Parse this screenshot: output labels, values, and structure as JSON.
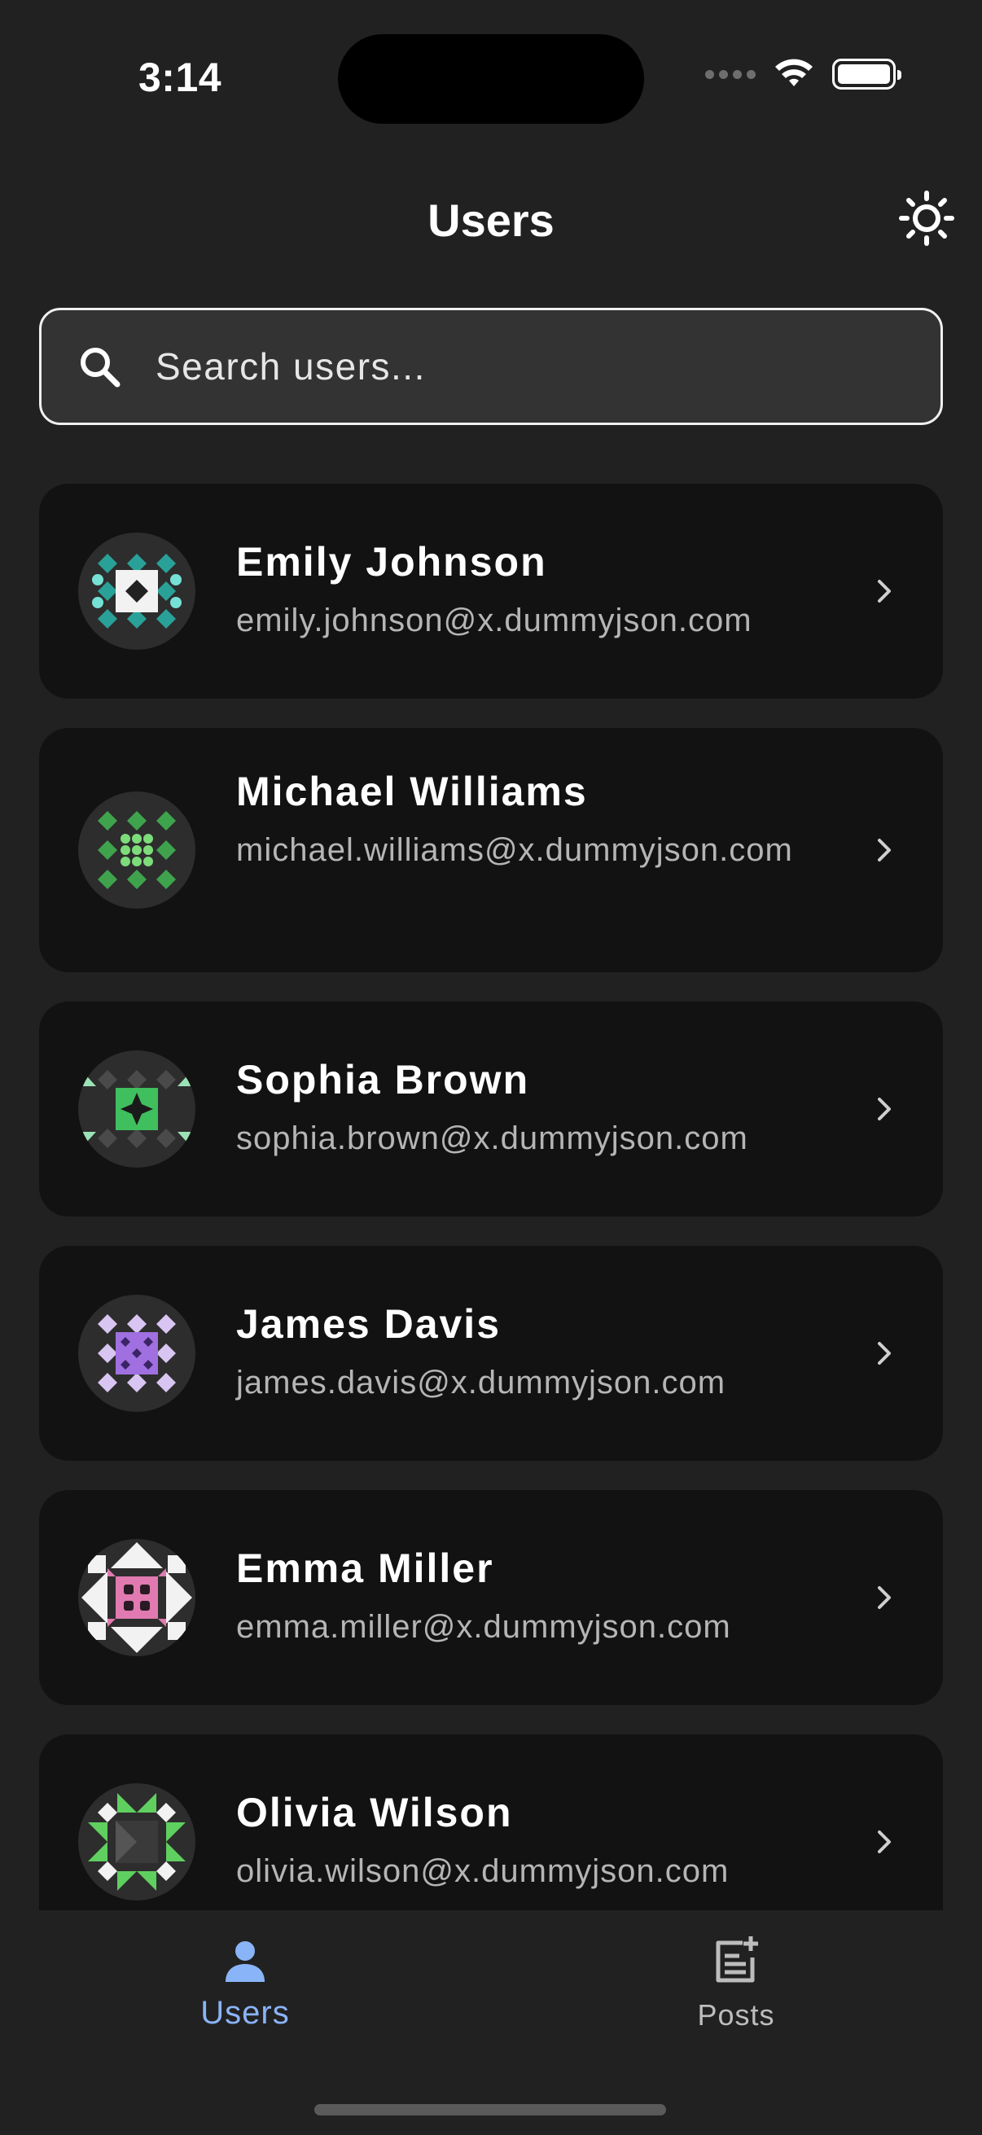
{
  "status_bar": {
    "time": "3:14"
  },
  "header": {
    "title": "Users"
  },
  "search": {
    "placeholder": "Search users..."
  },
  "users": [
    {
      "name": "Emily Johnson",
      "email": "emily.johnson@x.dummyjson.com"
    },
    {
      "name": "Michael Williams",
      "email": "michael.williams@x.dummyjson.com"
    },
    {
      "name": "Sophia Brown",
      "email": "sophia.brown@x.dummyjson.com"
    },
    {
      "name": "James Davis",
      "email": "james.davis@x.dummyjson.com"
    },
    {
      "name": "Emma Miller",
      "email": "emma.miller@x.dummyjson.com"
    },
    {
      "name": "Olivia Wilson",
      "email": "olivia.wilson@x.dummyjson.com"
    }
  ],
  "bottom_nav": [
    {
      "label": "Users",
      "icon": "person-icon",
      "active": true
    },
    {
      "label": "Posts",
      "icon": "post-add-icon",
      "active": false
    }
  ],
  "colors": {
    "background": "#212121",
    "card": "#121212",
    "accent": "#8ab4f8",
    "secondary_text": "#b5b5b5"
  }
}
